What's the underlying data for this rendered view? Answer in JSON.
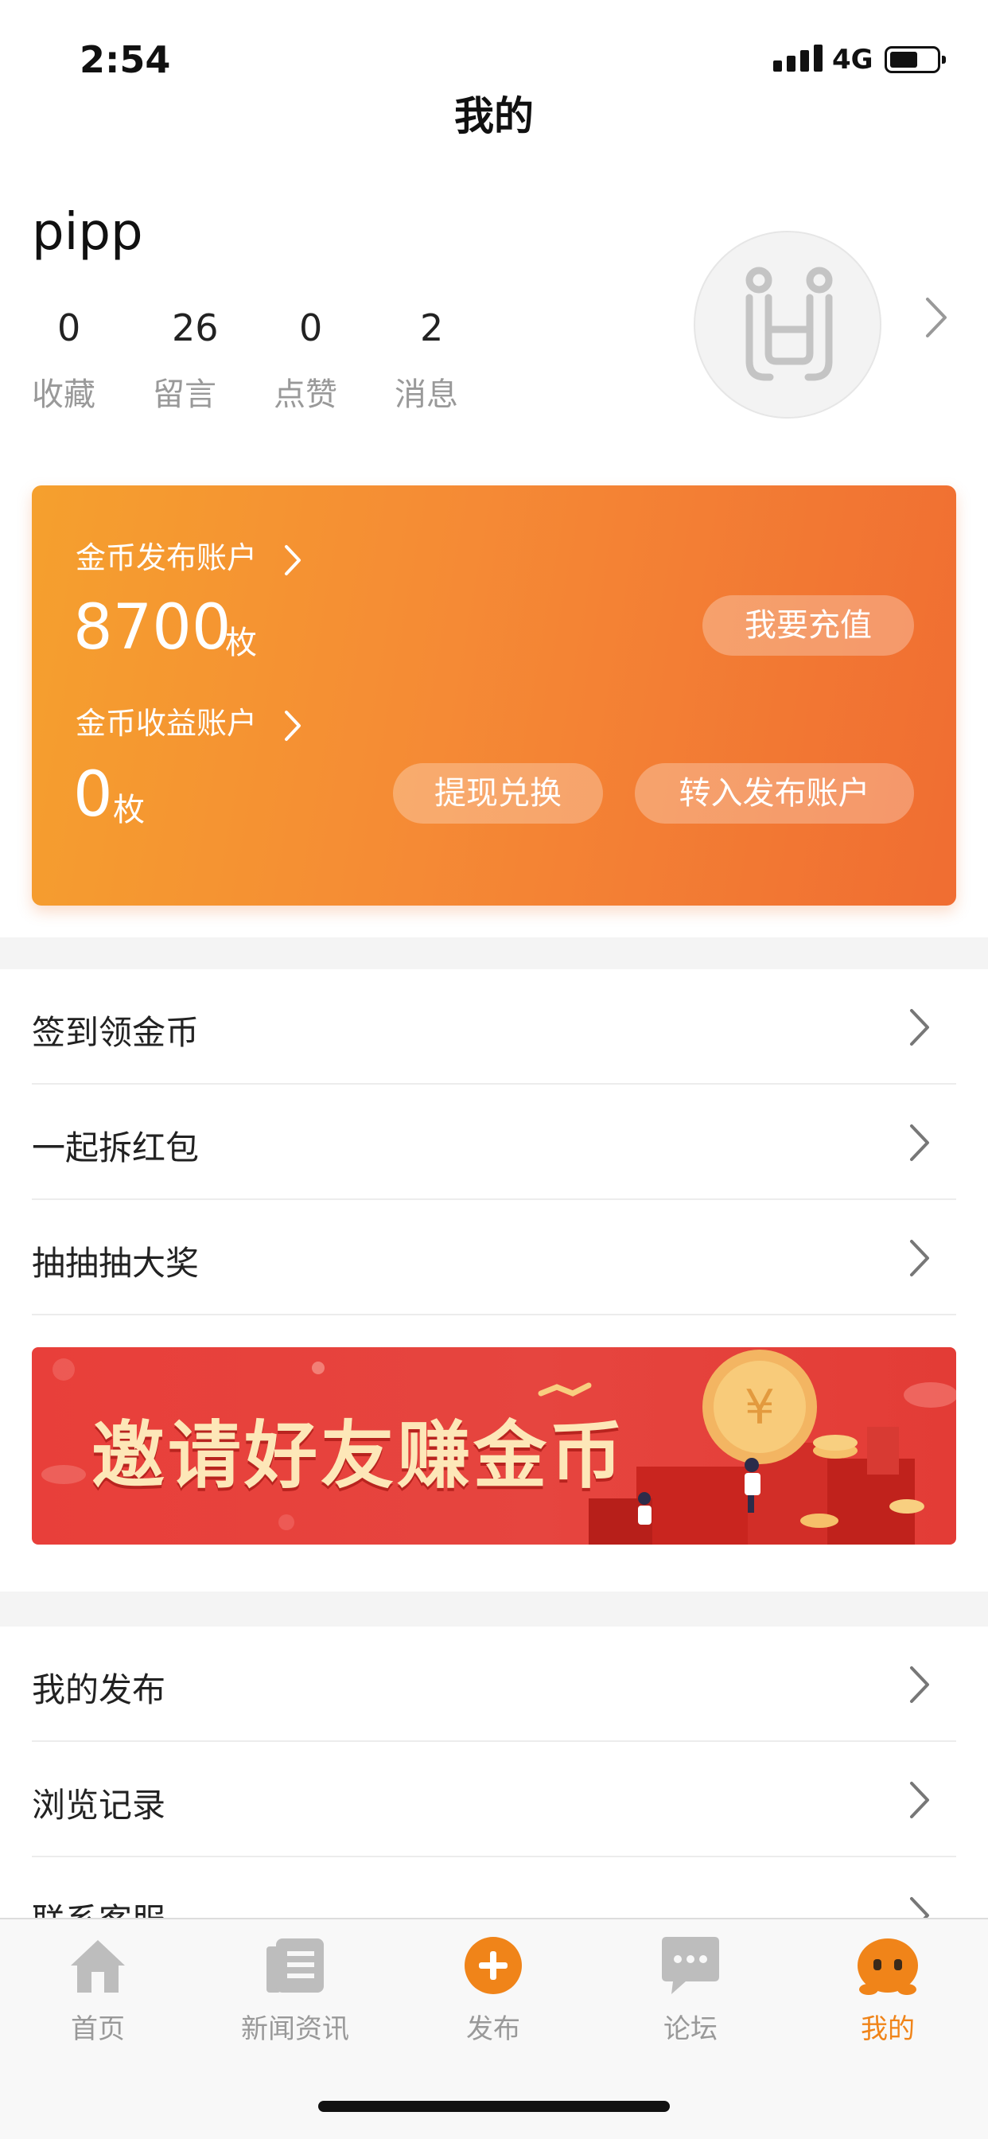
{
  "status_bar": {
    "time": "2:54",
    "network": "4G"
  },
  "header": {
    "title": "我的"
  },
  "profile": {
    "username": "pipp",
    "stats": [
      {
        "value": "0",
        "label": "收藏"
      },
      {
        "value": "26",
        "label": "留言"
      },
      {
        "value": "0",
        "label": "点赞"
      },
      {
        "value": "2",
        "label": "消息"
      }
    ]
  },
  "coin_card": {
    "publish_account": {
      "title": "金币发布账户",
      "amount": "8700",
      "unit": "枚",
      "recharge_label": "我要充值"
    },
    "income_account": {
      "title": "金币收益账户",
      "amount": "0",
      "unit": "枚",
      "withdraw_label": "提现兑换",
      "transfer_label": "转入发布账户"
    }
  },
  "menu_group_1": [
    {
      "label": "签到领金币"
    },
    {
      "label": "一起拆红包"
    },
    {
      "label": "抽抽抽大奖"
    }
  ],
  "banner": {
    "text": "邀请好友赚金币"
  },
  "menu_group_2": [
    {
      "label": "我的发布"
    },
    {
      "label": "浏览记录"
    },
    {
      "label": "联系客服"
    }
  ],
  "tabbar": {
    "items": [
      {
        "label": "首页",
        "icon": "home-icon"
      },
      {
        "label": "新闻资讯",
        "icon": "news-icon"
      },
      {
        "label": "发布",
        "icon": "plus-icon"
      },
      {
        "label": "论坛",
        "icon": "chat-bubble-icon"
      },
      {
        "label": "我的",
        "icon": "profile-mascot-icon"
      }
    ],
    "active_index": 4
  },
  "colors": {
    "accent": "#f08419",
    "card_start": "#f5a02e",
    "card_end": "#f06d32",
    "banner": "#e6453f"
  }
}
